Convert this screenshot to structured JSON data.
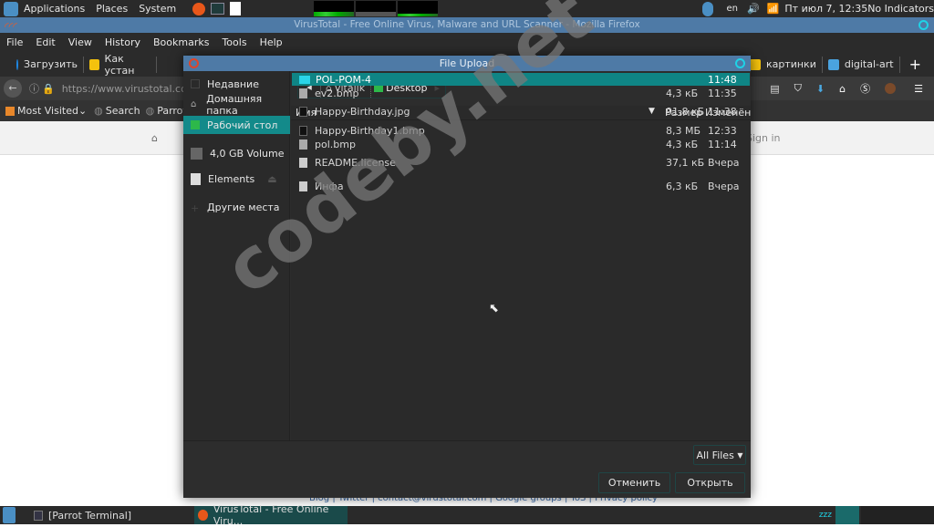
{
  "top_panel": {
    "menus": [
      "Applications",
      "Places",
      "System"
    ],
    "lang": "en",
    "clock": "Пт июл  7, 12:35",
    "indicators": "No Indicators"
  },
  "firefox": {
    "title": "VirusTotal - Free Online Virus, Malware and URL Scanner - Mozilla Firefox",
    "menu": [
      "File",
      "Edit",
      "View",
      "History",
      "Bookmarks",
      "Tools",
      "Help"
    ],
    "tabs": [
      {
        "label": "Загрузить",
        "color": "#1e88e5"
      },
      {
        "label": "Как устан",
        "color": "#f4c20d"
      },
      {
        "label": "картинки",
        "color": "#f4c20d"
      },
      {
        "label": "digital-art",
        "color": "#4aa3df"
      }
    ],
    "url": "https://www.virustotal.com",
    "bookmarks": [
      "Most Visited",
      "Search",
      "Parrot"
    ],
    "page": {
      "sign_in": "Sign in",
      "footer": [
        "Blog",
        "Twitter",
        "contact@virustotal.com",
        "Google groups",
        "ToS",
        "Privacy policy"
      ]
    }
  },
  "dialog": {
    "title": "File Upload",
    "sidebar": [
      "Недавние",
      "Домашняя папка",
      "Рабочий стол",
      "4,0 GB Volume",
      "Elements",
      "Другие места"
    ],
    "path": [
      "vitalik",
      "Desktop"
    ],
    "columns": {
      "name": "Имя",
      "size": "Размер",
      "modified": "Изменён"
    },
    "files": [
      {
        "name": "POL-POM-4",
        "size": "",
        "time": "11:48",
        "type": "folder"
      },
      {
        "name": "ev2.bmp",
        "size": "4,3 кБ",
        "time": "11:35",
        "type": "image"
      },
      {
        "name": "Happy-Birthday.jpg",
        "size": "91,8 кБ",
        "time": "11:38",
        "type": "image-thumb"
      },
      {
        "name": "Happy-Birthday1.bmp",
        "size": "8,3 МБ",
        "time": "12:33",
        "type": "image-thumb"
      },
      {
        "name": "pol.bmp",
        "size": "4,3 кБ",
        "time": "11:14",
        "type": "image"
      },
      {
        "name": "README.license",
        "size": "37,1 кБ",
        "time": "Вчера",
        "type": "text"
      },
      {
        "name": "Инфа",
        "size": "6,3 кБ",
        "time": "Вчера",
        "type": "text"
      }
    ],
    "filter": "All Files",
    "cancel": "Отменить",
    "open": "Открыть"
  },
  "taskbar": [
    "[Parrot Terminal]",
    "VirusTotal - Free Online Viru..."
  ],
  "watermark": "codeby.net"
}
